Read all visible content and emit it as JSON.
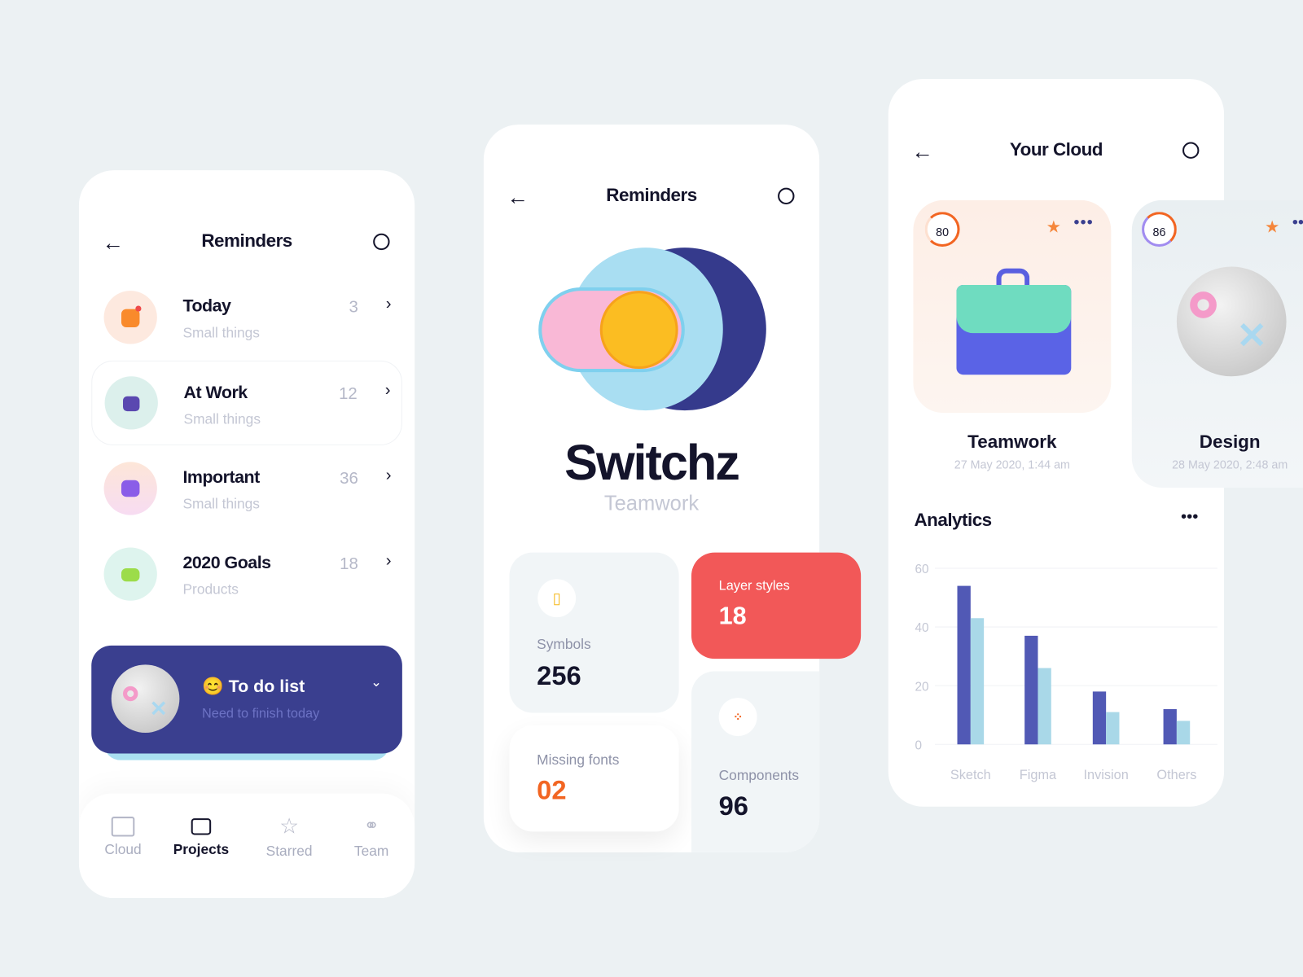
{
  "screen1": {
    "title": "Reminders",
    "items": [
      {
        "title": "Today",
        "subtitle": "Small things",
        "count": "3",
        "icon": "chart-app-icon"
      },
      {
        "title": "At Work",
        "subtitle": "Small things",
        "count": "12",
        "icon": "bag-icon"
      },
      {
        "title": "Important",
        "subtitle": "Small things",
        "count": "36",
        "icon": "folder-icon"
      },
      {
        "title": "2020 Goals",
        "subtitle": "Products",
        "count": "18",
        "icon": "gamepad-icon"
      }
    ],
    "todo": {
      "emoji": "😊",
      "title": "To do list",
      "subtitle": "Need to finish today"
    },
    "nav": [
      {
        "label": "Cloud",
        "icon": "cloud-folder-icon"
      },
      {
        "label": "Projects",
        "icon": "projects-icon",
        "active": true
      },
      {
        "label": "Starred",
        "icon": "star-list-icon"
      },
      {
        "label": "Team",
        "icon": "team-icon"
      }
    ]
  },
  "screen2": {
    "title": "Reminders",
    "app_name": "Switchz",
    "app_sub": "Teamwork",
    "tiles": {
      "symbols": {
        "label": "Symbols",
        "value": "256"
      },
      "layer_styles": {
        "label": "Layer styles",
        "value": "18"
      },
      "missing_fonts": {
        "label": "Missing fonts",
        "value": "02"
      },
      "components": {
        "label": "Components",
        "value": "96"
      }
    }
  },
  "screen3": {
    "title": "Your Cloud",
    "projects": [
      {
        "name": "Teamwork",
        "date": "27 May 2020, 1:44 am",
        "score": "80"
      },
      {
        "name": "Design",
        "date": "28 May 2020, 2:48 am",
        "score": "86"
      }
    ],
    "analytics_title": "Analytics"
  },
  "colors": {
    "navy": "#3a3f8f",
    "red": "#f25858",
    "orange": "#f26522",
    "bar_dark": "#5159b5",
    "bar_light": "#a9d8e8"
  },
  "chart_data": {
    "type": "bar",
    "categories": [
      "Sketch",
      "Figma",
      "Invision",
      "Others"
    ],
    "series": [
      {
        "values": [
          54,
          37,
          18,
          12
        ]
      },
      {
        "values": [
          43,
          26,
          11,
          8
        ]
      }
    ],
    "yticks": [
      "60",
      "40",
      "20",
      "0"
    ],
    "ylim": [
      0,
      60
    ],
    "grid": true
  }
}
